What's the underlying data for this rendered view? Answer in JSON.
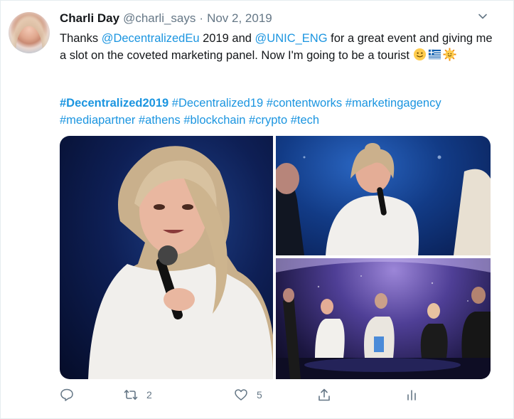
{
  "tweet": {
    "author_name": "Charli Day",
    "author_handle": "@charli_says",
    "separator": "·",
    "date": "Nov 2, 2019",
    "text_thanks": "Thanks ",
    "mention_1": "@DecentralizedEu",
    "text_mid": " 2019 and ",
    "mention_2": "@UNIC_ENG",
    "text_rest": " for a great event and giving me a slot on the coveted marketing panel. Now I'm going to be a tourist ",
    "emojis": [
      "slightly-smiling-face-icon",
      "greece-flag-icon",
      "sun-with-face-icon"
    ],
    "hashtags": [
      "#Decentralized2019",
      "#Decentralized19",
      "#contentworks",
      "#marketingagency",
      "#mediapartner",
      "#athens",
      "#blockchain",
      "#crypto",
      "#tech"
    ]
  },
  "media": {
    "photos": [
      {
        "name": "speaker-closeup-photo"
      },
      {
        "name": "speaker-panel-photo"
      },
      {
        "name": "panel-stage-photo"
      }
    ]
  },
  "actions": {
    "reply_icon": "reply-icon",
    "retweet_count": "2",
    "like_count": "5",
    "share_icon": "share-icon",
    "analytics_icon": "analytics-icon"
  },
  "colors": {
    "link": "#1b95e0",
    "muted": "#657786",
    "text": "#14171a"
  }
}
